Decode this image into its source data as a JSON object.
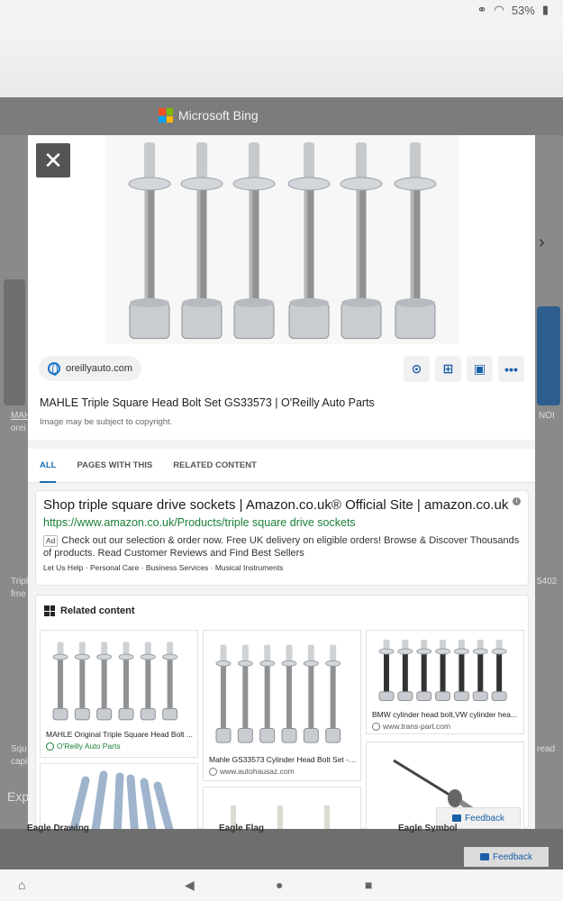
{
  "status_bar": {
    "battery": "53%"
  },
  "background": {
    "brand": "Microsoft Bing",
    "texts": {
      "left_caption_1": "MAH",
      "left_caption_2": "orei",
      "left_caption_3": "Tripl",
      "left_caption_4": "fme",
      "left_caption_5": "Squ",
      "left_caption_6": "capi",
      "explore": "Exp",
      "right_caption_1": "NOI",
      "right_caption_2": "5402",
      "right_caption_3": "read"
    },
    "bottom_labels": [
      "Eagle Drawing",
      "Eagle Flag",
      "Eagle Symbol"
    ],
    "feedback": "Feedback"
  },
  "modal": {
    "close_icon": "close-icon",
    "source": "oreillyauto.com",
    "actions": [
      "visual-search-icon",
      "add-to-collection-icon",
      "image-icon",
      "more-icon"
    ],
    "title": "MAHLE Triple Square Head Bolt Set GS33573 | O'Reilly Auto Parts",
    "copyright": "Image may be subject to copyright.",
    "tabs": [
      "ALL",
      "PAGES WITH THIS",
      "RELATED CONTENT"
    ],
    "active_tab": "ALL",
    "ad": {
      "title": "Shop triple square drive sockets | Amazon.co.uk® Official Site | amazon.co.uk",
      "url": "https://www.amazon.co.uk/Products/triple square drive sockets",
      "label": "Ad",
      "body": "Check out our selection & order now. Free UK delivery on eligible orders! Browse & Discover Thousands of products. Read Customer Reviews and Find Best Sellers",
      "links": "Let Us Help · Personal Care · Business Services · Musical Instruments"
    },
    "related": {
      "heading": "Related content",
      "cards": [
        {
          "caption": "MAHLE Original Triple Square Head Bolt ...",
          "source": "O'Reilly Auto Parts"
        },
        {
          "caption": "Mahle GS33573 Cylinder Head Bolt Set - ...",
          "source": "www.autohausaz.com"
        },
        {
          "caption": "BMW cylinder head bolt,VW cylinder hea...",
          "source": "www.trans-part.com"
        }
      ]
    },
    "feedback": "Feedback"
  }
}
